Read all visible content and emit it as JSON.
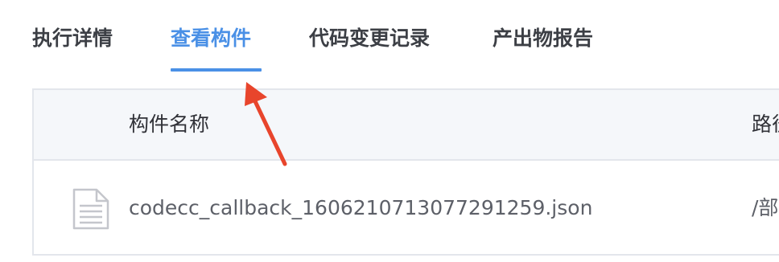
{
  "tabs": [
    {
      "label": "执行详情",
      "active": false
    },
    {
      "label": "查看构件",
      "active": true
    },
    {
      "label": "代码变更记录",
      "active": false
    },
    {
      "label": "产出物报告",
      "active": false
    }
  ],
  "table": {
    "columns": [
      "构件名称",
      "路径"
    ],
    "rows": [
      {
        "name": "codecc_callback_1606210713077291259.json",
        "path": "/部"
      }
    ]
  },
  "colors": {
    "accent": "#4a90e6",
    "annotation_arrow": "#e8452c"
  },
  "icons": {
    "file": "file-text-icon",
    "annotation": "red-arrow-annotation-icon"
  }
}
